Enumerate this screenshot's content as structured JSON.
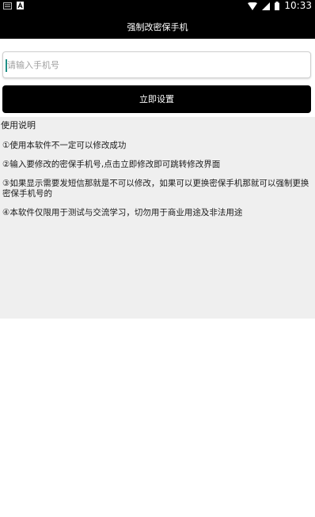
{
  "status_bar": {
    "time": "10:33",
    "icons": [
      "sim-icon",
      "notification-a-icon",
      "wifi-icon",
      "signal-icon",
      "battery-icon"
    ],
    "background": "#000000"
  },
  "app_bar": {
    "title": "强制改密保手机",
    "background": "#000000"
  },
  "form": {
    "phone_placeholder": "请输入手机号",
    "submit_label": "立即设置",
    "accent": "#1e8f86"
  },
  "instructions": {
    "title": "使用说明",
    "items": [
      "①使用本软件不一定可以修改成功",
      "②输入要修改的密保手机号,点击立即修改即可跳转修改界面",
      "③如果显示需要发短信那就是不可以修改，如果可以更换密保手机那就可以强制更换密保手机号的",
      "④本软件仅限用于测试与交流学习，切勿用于商业用途及非法用途"
    ],
    "background": "#efefef"
  }
}
